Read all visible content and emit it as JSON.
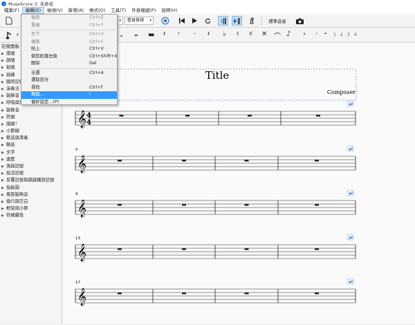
{
  "window": {
    "title": "MuseScore 3: 未命名"
  },
  "menubar": [
    "檔案(F)",
    "編輯(E)",
    "檢視(V)",
    "新增(A)",
    "格式(O)",
    "工具(T)",
    "外掛模組(P)",
    "說明(H)"
  ],
  "edit_menu": {
    "items": [
      {
        "label": "復原",
        "shortcut": "Ctrl+Z",
        "disabled": true
      },
      {
        "label": "重複",
        "shortcut": "Ctrl+Y",
        "disabled": true
      },
      {
        "separator": true
      },
      {
        "label": "剪下",
        "shortcut": "Ctrl+X",
        "disabled": true
      },
      {
        "label": "複製",
        "shortcut": "Ctrl+C",
        "disabled": true
      },
      {
        "label": "貼上",
        "shortcut": "Ctrl+V"
      },
      {
        "label": "倒剪貼簿左換",
        "shortcut": "Ctrl+Shift+X"
      },
      {
        "label": "刪除",
        "shortcut": "Del"
      },
      {
        "separator": true
      },
      {
        "label": "全選",
        "shortcut": "Ctrl+A"
      },
      {
        "label": "選取部分",
        "shortcut": ""
      },
      {
        "label": "尋找",
        "shortcut": "Ctrl+F"
      },
      {
        "label": "樂器…",
        "shortcut": "I",
        "highlighted": true
      },
      {
        "label": "偏好設定…(P)",
        "shortcut": ""
      }
    ]
  },
  "toolbar": {
    "view_mode": "整頁檢視",
    "zoom": "",
    "concert_pitch": "標準音高",
    "voice_numbers": [
      "1",
      "2",
      "3",
      "4"
    ]
  },
  "palette": {
    "header": "記號面板",
    "items": [
      "譜號",
      "調號",
      "拍號",
      "括線",
      "臨時記號",
      "演奏法",
      "裝飾音",
      "呼吸與停頓",
      "裝飾音",
      "符頭",
      "譜線！",
      "小節線",
      "歇音與滑奏",
      "顫音",
      "文字",
      "速度",
      "強弱記號",
      "指法記號",
      "反覆記號與跳越播放記號",
      "指板圖",
      "風笛裝飾音",
      "換行與空白",
      "框架與小節",
      "符槓屬性"
    ]
  },
  "score": {
    "title": "Title",
    "composer": "Composer",
    "time_signature": {
      "num": "4",
      "den": "4"
    },
    "system_measure_numbers": [
      "",
      "5",
      "9",
      "13",
      "17"
    ]
  }
}
